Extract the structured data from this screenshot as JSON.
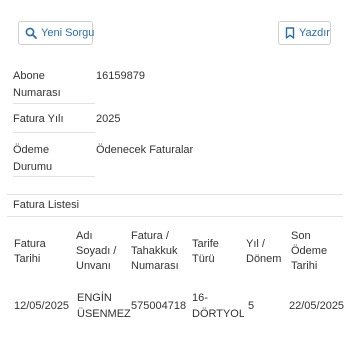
{
  "toolbar": {
    "search_label": "Yeni Sorgu",
    "search_icon": "search-icon",
    "print_label": "Yazdır",
    "print_icon": "bookmark-icon",
    "accent_color": "#2e6da4"
  },
  "details": {
    "subscriber_label": "Abone\nNumarası",
    "subscriber_value": "16159879",
    "year_label": "Fatura Yılı",
    "year_value": "2025",
    "payment_label": "Ödeme\nDurumu",
    "payment_value": "Ödenecek Faturalar"
  },
  "invoice_list": {
    "title": "Fatura Listesi",
    "headers": [
      "Fatura\nTarihi",
      "Adı\nSoyadı /\nUnvanı",
      "Fatura /\nTahakkuk\nNumarası",
      "Tarife\nTürü",
      "Yıl /\nDönem",
      "Son\nÖdeme\nTarihi"
    ],
    "rows": [
      {
        "date": "12/05/2025",
        "name": "ENGİN\nÜSENMEZ",
        "number": "575004718",
        "tariff": "16-\nDÖRTYOL",
        "period": "5",
        "due": "22/05/2025"
      }
    ]
  }
}
